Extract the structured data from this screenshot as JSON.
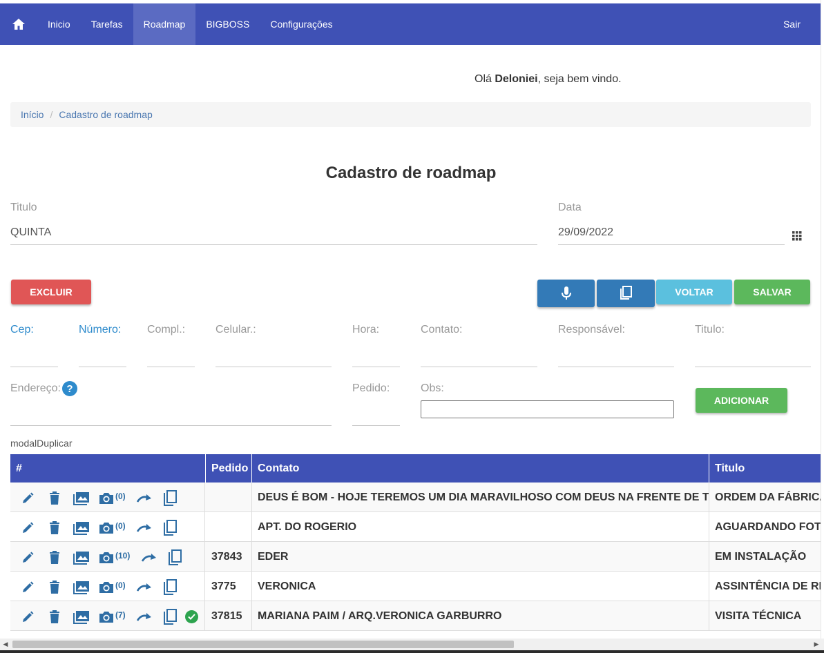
{
  "nav": {
    "items": [
      "Inicio",
      "Tarefas",
      "Roadmap",
      "BIGBOSS",
      "Configurações"
    ],
    "active": "Roadmap",
    "logout": "Sair",
    "color": "#3f51b5"
  },
  "greeting": {
    "prefix": "Olá ",
    "name": "Deloniei",
    "suffix": ", seja bem vindo."
  },
  "breadcrumb": {
    "home": "Início",
    "sep": "/",
    "current": "Cadastro de roadmap"
  },
  "page_title": "Cadastro de roadmap",
  "form": {
    "titulo_label": "Titulo",
    "titulo_value": "QUINTA",
    "data_label": "Data",
    "data_value": "29/09/2022"
  },
  "buttons": {
    "excluir": "EXCLUIR",
    "voltar": "VOLTAR",
    "salvar": "SALVAR",
    "adicionar": "ADICIONAR"
  },
  "fields": {
    "cep": "Cep:",
    "numero": "Número:",
    "compl": "Compl.:",
    "celular": "Celular.:",
    "hora": "Hora:",
    "contato": "Contato:",
    "responsavel": "Responsável:",
    "titulo": "Titulo:",
    "endereco": "Endereço:",
    "pedido": "Pedido:",
    "obs": "Obs:"
  },
  "help_glyph": "?",
  "modal_text": "modalDuplicar",
  "table": {
    "headers": {
      "hash": "#",
      "pedido": "Pedido",
      "contato": "Contato",
      "titulo": "Titulo"
    },
    "rows": [
      {
        "photos": "(0)",
        "pedido": "",
        "contato": "DEUS É BOM - HOJE TEREMOS UM DIA MARAVILHOSO COM DEUS NA FRENTE DE TUDO.",
        "titulo": "ORDEM DA FÁBRICA",
        "done": false
      },
      {
        "photos": "(0)",
        "pedido": "",
        "contato": "APT. DO ROGERIO",
        "titulo": "AGUARDANDO FOTO",
        "done": false
      },
      {
        "photos": "(10)",
        "pedido": "37843",
        "contato": "EDER",
        "titulo": "EM INSTALAÇÃO",
        "done": false
      },
      {
        "photos": "(0)",
        "pedido": "3775",
        "contato": "VERONICA",
        "titulo": "ASSINTÊNCIA DE RE...",
        "done": false
      },
      {
        "photos": "(7)",
        "pedido": "37815",
        "contato": "MARIANA PAIM / ARQ.VERONICA GARBURRO",
        "titulo": "VISITA TÉCNICA",
        "done": true
      }
    ]
  }
}
